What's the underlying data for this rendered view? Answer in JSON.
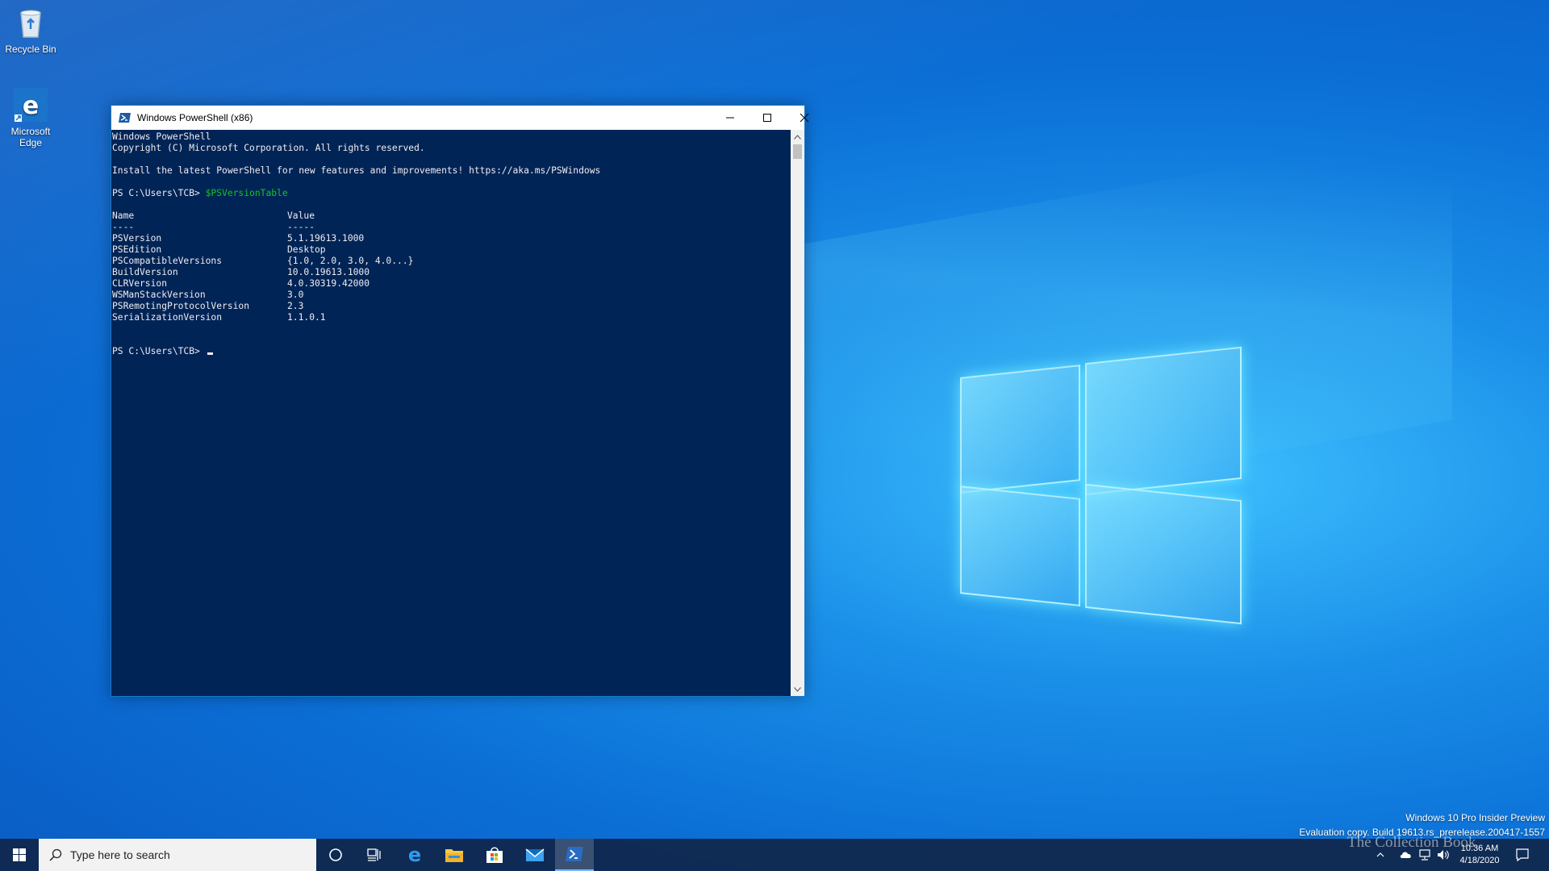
{
  "desktop": {
    "icons": [
      {
        "label": "Recycle Bin",
        "icon": "recycle-bin-icon"
      },
      {
        "label": "Microsoft Edge",
        "label_line1": "Microsoft",
        "label_line2": "Edge",
        "icon": "edge-icon"
      }
    ]
  },
  "window": {
    "title": "Windows PowerShell (x86)",
    "icon": "powershell-icon",
    "controls": {
      "minimize": "minimize-icon",
      "maximize": "maximize-icon",
      "close": "close-icon"
    },
    "console": {
      "banner1": "Windows PowerShell",
      "banner2": "Copyright (C) Microsoft Corporation. All rights reserved.",
      "banner3": "Install the latest PowerShell for new features and improvements! https://aka.ms/PSWindows",
      "prompt": "PS C:\\Users\\TCB> ",
      "command": "$PSVersionTable",
      "header_name": "Name",
      "header_value": "Value",
      "header_rule_name": "----",
      "header_rule_value": "-----",
      "rows": [
        {
          "name": "PSVersion",
          "value": "5.1.19613.1000"
        },
        {
          "name": "PSEdition",
          "value": "Desktop"
        },
        {
          "name": "PSCompatibleVersions",
          "value": "{1.0, 2.0, 3.0, 4.0...}"
        },
        {
          "name": "BuildVersion",
          "value": "10.0.19613.1000"
        },
        {
          "name": "CLRVersion",
          "value": "4.0.30319.42000"
        },
        {
          "name": "WSManStackVersion",
          "value": "3.0"
        },
        {
          "name": "PSRemotingProtocolVersion",
          "value": "2.3"
        },
        {
          "name": "SerializationVersion",
          "value": "1.1.0.1"
        }
      ],
      "final_prompt": "PS C:\\Users\\TCB> "
    },
    "colors": {
      "console_bg": "#012456",
      "command": "#13c51f",
      "text": "#eeedf0"
    }
  },
  "watermark": {
    "line1": "Windows 10 Pro Insider Preview",
    "line2": "Evaluation copy. Build 19613.rs_prerelease.200417-1557"
  },
  "taskbar": {
    "start": "windows-start-icon",
    "search_placeholder": "Type here to search",
    "apps": [
      "cortana-icon",
      "task-view-icon",
      "edge-icon",
      "file-explorer-icon",
      "store-icon",
      "mail-icon",
      "powershell-icon"
    ],
    "clock_time": "10:36 AM",
    "clock_date": "4/18/2020",
    "overlay_text": "The Collection Book"
  }
}
